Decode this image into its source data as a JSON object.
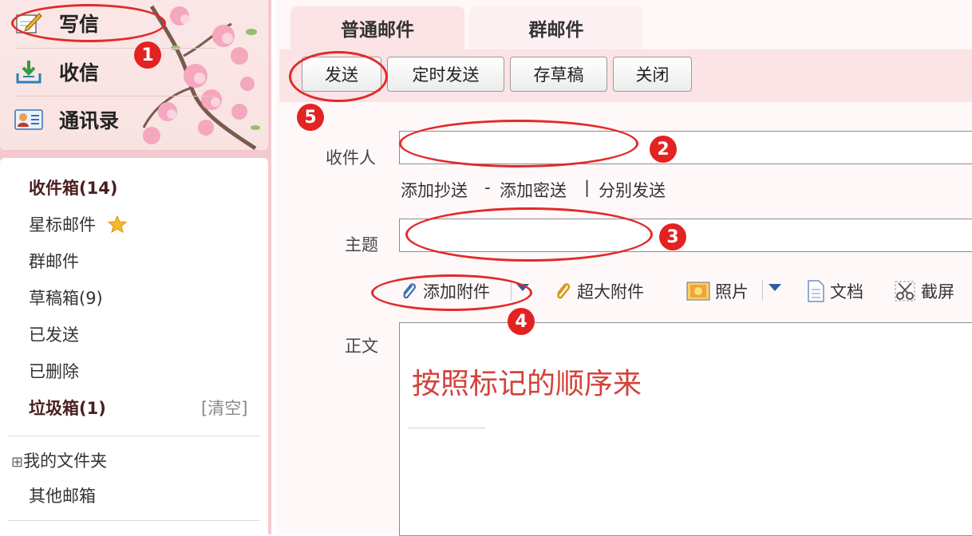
{
  "quick_actions": [
    {
      "label": "写信",
      "icon": "pencil-icon"
    },
    {
      "label": "收信",
      "icon": "inbox-download-icon"
    },
    {
      "label": "通讯录",
      "icon": "contact-card-icon"
    }
  ],
  "folders": {
    "inbox": "收件箱(14)",
    "starred": "星标邮件",
    "group": "群邮件",
    "drafts": "草稿箱(9)",
    "sent": "已发送",
    "deleted": "已删除",
    "spam": "垃圾箱(1)",
    "clear": "[清空]",
    "my_folders": "我的文件夹",
    "other_mailboxes": "其他邮箱",
    "expand_symbol": "⊞"
  },
  "tabs": [
    "普通邮件",
    "群邮件"
  ],
  "toolbar": {
    "send": "发送",
    "scheduled_send": "定时发送",
    "save_draft": "存草稿",
    "close": "关闭"
  },
  "compose": {
    "recipient_label": "收件人",
    "recipient_value": "",
    "add_cc": "添加抄送",
    "dash": "-",
    "add_bcc": "添加密送",
    "pipe": "|",
    "separate_send": "分别发送",
    "subject_label": "主题",
    "subject_value": "",
    "attachments": {
      "add_attachment": "添加附件",
      "large_attachment": "超大附件",
      "photo": "照片",
      "document": "文档",
      "screenshot": "截屏"
    },
    "body_label": "正文",
    "body_text": "按照标记的顺序来"
  },
  "annotations": [
    "1",
    "2",
    "3",
    "4",
    "5"
  ],
  "colors": {
    "annotation_red": "#e22a2a",
    "body_text_red": "#d2423b",
    "sidebar_pink": "#f3c9cf",
    "toolbar_pink": "#fbe3e6"
  }
}
